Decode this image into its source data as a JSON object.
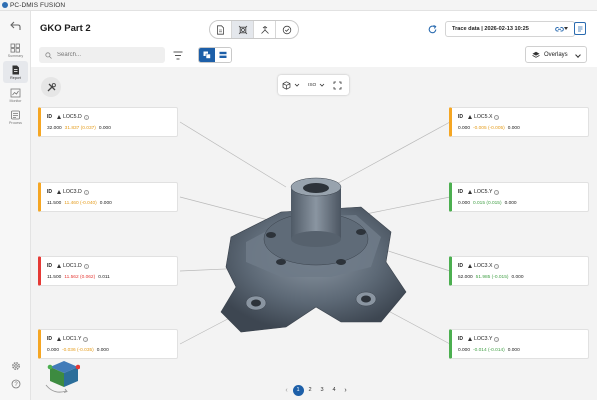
{
  "app": {
    "title": "PC-DMIS FUSION"
  },
  "sidebar": {
    "back_icon": "back-arrow-icon",
    "items": [
      {
        "label": "Summary",
        "icon": "grid-icon",
        "active": false
      },
      {
        "label": "Report",
        "icon": "document-icon",
        "active": true
      },
      {
        "label": "Monitor",
        "icon": "chart-icon",
        "active": false
      },
      {
        "label": "Process",
        "icon": "list-icon",
        "active": false
      }
    ]
  },
  "header": {
    "title": "GKO Part 2",
    "modes": [
      "document-icon",
      "inspect-icon",
      "connect-icon",
      "check-icon"
    ],
    "active_mode": 1,
    "trace_label": "Trace data | 2026-02-13 10:25"
  },
  "toolbar": {
    "search_placeholder": "Search...",
    "overlays_label": "Overlays"
  },
  "viewer": {
    "view_mode": "ISO",
    "cards": [
      {
        "id": "ID",
        "name": "LOC5.D",
        "nominal": "32.000",
        "measured": "31.837 (0.037)",
        "tol": "0.000",
        "status": "orange",
        "side": "left",
        "slot": 0
      },
      {
        "id": "ID",
        "name": "LOC3.D",
        "nominal": "11.500",
        "measured": "11.460 (-0.040)",
        "tol": "0.000",
        "status": "orange",
        "side": "left",
        "slot": 1
      },
      {
        "id": "ID",
        "name": "LOC1.D",
        "nominal": "11.500",
        "measured": "11.562 (0.062)",
        "tol": "0.011",
        "status": "red",
        "side": "left",
        "slot": 2
      },
      {
        "id": "ID",
        "name": "LOC1.Y",
        "nominal": "0.000",
        "measured": "-0.036 (-0.035)",
        "tol": "0.000",
        "status": "orange",
        "side": "left",
        "slot": 3
      },
      {
        "id": "ID",
        "name": "LOC5.X",
        "nominal": "0.000",
        "measured": "-0.005 (-0.005)",
        "tol": "0.000",
        "status": "orange",
        "side": "right",
        "slot": 0
      },
      {
        "id": "ID",
        "name": "LOC5.Y",
        "nominal": "0.000",
        "measured": "0.015 (0.015)",
        "tol": "0.000",
        "status": "green",
        "side": "right",
        "slot": 1
      },
      {
        "id": "ID",
        "name": "LOC3.X",
        "nominal": "52.000",
        "measured": "51.985 (-0.015)",
        "tol": "0.000",
        "status": "green",
        "side": "right",
        "slot": 2
      },
      {
        "id": "ID",
        "name": "LOC3.Y",
        "nominal": "0.000",
        "measured": "-0.014 (-0.014)",
        "tol": "0.000",
        "status": "green",
        "side": "right",
        "slot": 3
      }
    ]
  },
  "pagination": {
    "pages": [
      "1",
      "2",
      "3",
      "4"
    ],
    "current": "1"
  },
  "colors": {
    "accent": "#1d5fa8",
    "ok": "#4caf50",
    "warn": "#f5a623",
    "fail": "#e53935"
  }
}
